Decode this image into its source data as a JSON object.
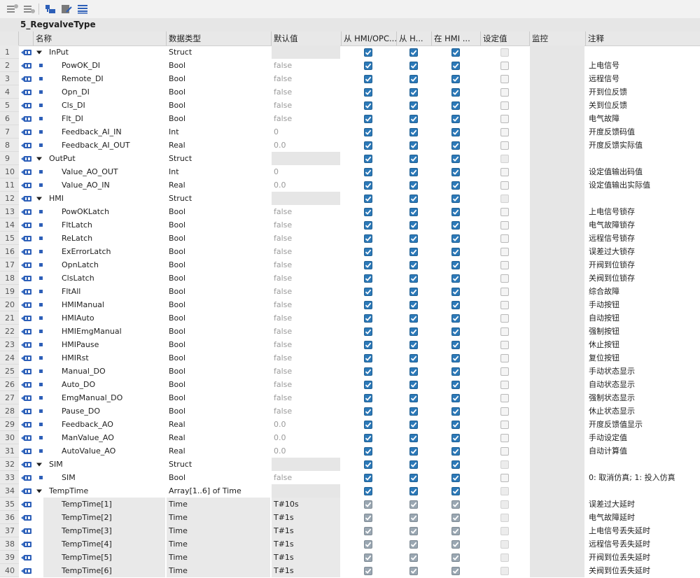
{
  "block_title": "5_RegvalveType",
  "toolbar": {
    "icons": [
      "insert-row-icon",
      "add-row-icon",
      "expand-icon",
      "monitor-icon",
      "details-icon"
    ]
  },
  "columns": {
    "name": "名称",
    "datatype": "数据类型",
    "default": "默认值",
    "hmi_opc": "从 HMI/OPC...",
    "hmi_h": "从 H...",
    "in_hmi": "在 HMI ...",
    "setpoint": "设定值",
    "monitor": "监控",
    "comment": "注释"
  },
  "colors": {
    "accent": "#2c79b8",
    "header_bg": "#e8e8e8"
  },
  "rows": [
    {
      "num": "1",
      "name": "InPut",
      "type": "Struct",
      "def": "",
      "level": 0,
      "struct": true,
      "comment": "",
      "c1": true,
      "c2": true,
      "c3": true,
      "c4": false
    },
    {
      "num": "2",
      "name": "PowOK_DI",
      "type": "Bool",
      "def": "false",
      "level": 1,
      "comment": "上电信号",
      "c1": true,
      "c2": true,
      "c3": true,
      "c4": false
    },
    {
      "num": "3",
      "name": "Remote_DI",
      "type": "Bool",
      "def": "false",
      "level": 1,
      "comment": "远程信号",
      "c1": true,
      "c2": true,
      "c3": true,
      "c4": false
    },
    {
      "num": "4",
      "name": "Opn_DI",
      "type": "Bool",
      "def": "false",
      "level": 1,
      "comment": "开到位反馈",
      "c1": true,
      "c2": true,
      "c3": true,
      "c4": false
    },
    {
      "num": "5",
      "name": "Cls_DI",
      "type": "Bool",
      "def": "false",
      "level": 1,
      "comment": "关到位反馈",
      "c1": true,
      "c2": true,
      "c3": true,
      "c4": false
    },
    {
      "num": "6",
      "name": "Flt_DI",
      "type": "Bool",
      "def": "false",
      "level": 1,
      "comment": "电气故障",
      "c1": true,
      "c2": true,
      "c3": true,
      "c4": false
    },
    {
      "num": "7",
      "name": "Feedback_AI_IN",
      "type": "Int",
      "def": "0",
      "level": 1,
      "comment": "开度反馈码值",
      "c1": true,
      "c2": true,
      "c3": true,
      "c4": false
    },
    {
      "num": "8",
      "name": "Feedback_AI_OUT",
      "type": "Real",
      "def": "0.0",
      "level": 1,
      "comment": "开度反馈实际值",
      "c1": true,
      "c2": true,
      "c3": true,
      "c4": false
    },
    {
      "num": "9",
      "name": "OutPut",
      "type": "Struct",
      "def": "",
      "level": 0,
      "struct": true,
      "comment": "",
      "c1": true,
      "c2": true,
      "c3": true,
      "c4": false
    },
    {
      "num": "10",
      "name": "Value_AO_OUT",
      "type": "Int",
      "def": "0",
      "level": 1,
      "comment": "设定值输出码值",
      "c1": true,
      "c2": true,
      "c3": true,
      "c4": false
    },
    {
      "num": "11",
      "name": "Value_AO_IN",
      "type": "Real",
      "def": "0.0",
      "level": 1,
      "comment": "设定值输出实际值",
      "c1": true,
      "c2": true,
      "c3": true,
      "c4": false
    },
    {
      "num": "12",
      "name": "HMI",
      "type": "Struct",
      "def": "",
      "level": 0,
      "struct": true,
      "comment": "",
      "c1": true,
      "c2": true,
      "c3": true,
      "c4": false
    },
    {
      "num": "13",
      "name": "PowOKLatch",
      "type": "Bool",
      "def": "false",
      "level": 1,
      "comment": "上电信号锁存",
      "c1": true,
      "c2": true,
      "c3": true,
      "c4": false
    },
    {
      "num": "14",
      "name": "FltLatch",
      "type": "Bool",
      "def": "false",
      "level": 1,
      "comment": "电气故障锁存",
      "c1": true,
      "c2": true,
      "c3": true,
      "c4": false
    },
    {
      "num": "15",
      "name": "ReLatch",
      "type": "Bool",
      "def": "false",
      "level": 1,
      "comment": "远程信号锁存",
      "c1": true,
      "c2": true,
      "c3": true,
      "c4": false
    },
    {
      "num": "16",
      "name": "ExErrorLatch",
      "type": "Bool",
      "def": "false",
      "level": 1,
      "comment": "误差过大锁存",
      "c1": true,
      "c2": true,
      "c3": true,
      "c4": false
    },
    {
      "num": "17",
      "name": "OpnLatch",
      "type": "Bool",
      "def": "false",
      "level": 1,
      "comment": "开阀到位锁存",
      "c1": true,
      "c2": true,
      "c3": true,
      "c4": false
    },
    {
      "num": "18",
      "name": "ClsLatch",
      "type": "Bool",
      "def": "false",
      "level": 1,
      "comment": "关阀到位锁存",
      "c1": true,
      "c2": true,
      "c3": true,
      "c4": false
    },
    {
      "num": "19",
      "name": "FltAll",
      "type": "Bool",
      "def": "false",
      "level": 1,
      "comment": "综合故障",
      "c1": true,
      "c2": true,
      "c3": true,
      "c4": false
    },
    {
      "num": "20",
      "name": "HMIManual",
      "type": "Bool",
      "def": "false",
      "level": 1,
      "comment": "手动按钮",
      "c1": true,
      "c2": true,
      "c3": true,
      "c4": false
    },
    {
      "num": "21",
      "name": "HMIAuto",
      "type": "Bool",
      "def": "false",
      "level": 1,
      "comment": "自动按钮",
      "c1": true,
      "c2": true,
      "c3": true,
      "c4": false
    },
    {
      "num": "22",
      "name": "HMIEmgManual",
      "type": "Bool",
      "def": "false",
      "level": 1,
      "comment": "强制按钮",
      "c1": true,
      "c2": true,
      "c3": true,
      "c4": false
    },
    {
      "num": "23",
      "name": "HMIPause",
      "type": "Bool",
      "def": "false",
      "level": 1,
      "comment": "休止按钮",
      "c1": true,
      "c2": true,
      "c3": true,
      "c4": false
    },
    {
      "num": "24",
      "name": "HMIRst",
      "type": "Bool",
      "def": "false",
      "level": 1,
      "comment": "复位按钮",
      "c1": true,
      "c2": true,
      "c3": true,
      "c4": false
    },
    {
      "num": "25",
      "name": "Manual_DO",
      "type": "Bool",
      "def": "false",
      "level": 1,
      "comment": "手动状态显示",
      "c1": true,
      "c2": true,
      "c3": true,
      "c4": false
    },
    {
      "num": "26",
      "name": "Auto_DO",
      "type": "Bool",
      "def": "false",
      "level": 1,
      "comment": "自动状态显示",
      "c1": true,
      "c2": true,
      "c3": true,
      "c4": false
    },
    {
      "num": "27",
      "name": "EmgManual_DO",
      "type": "Bool",
      "def": "false",
      "level": 1,
      "comment": "强制状态显示",
      "c1": true,
      "c2": true,
      "c3": true,
      "c4": false
    },
    {
      "num": "28",
      "name": "Pause_DO",
      "type": "Bool",
      "def": "false",
      "level": 1,
      "comment": "休止状态显示",
      "c1": true,
      "c2": true,
      "c3": true,
      "c4": false
    },
    {
      "num": "29",
      "name": "Feedback_AO",
      "type": "Real",
      "def": "0.0",
      "level": 1,
      "comment": "开度反馈值显示",
      "c1": true,
      "c2": true,
      "c3": true,
      "c4": false
    },
    {
      "num": "30",
      "name": "ManValue_AO",
      "type": "Real",
      "def": "0.0",
      "level": 1,
      "comment": "手动设定值",
      "c1": true,
      "c2": true,
      "c3": true,
      "c4": false
    },
    {
      "num": "31",
      "name": "AutoValue_AO",
      "type": "Real",
      "def": "0.0",
      "level": 1,
      "comment": "自动计算值",
      "c1": true,
      "c2": true,
      "c3": true,
      "c4": false
    },
    {
      "num": "32",
      "name": "SIM",
      "type": "Struct",
      "def": "",
      "level": 0,
      "struct": true,
      "comment": "",
      "c1": true,
      "c2": true,
      "c3": true,
      "c4": false
    },
    {
      "num": "33",
      "name": "SIM",
      "type": "Bool",
      "def": "false",
      "level": 1,
      "comment": "0: 取消仿真; 1: 投入仿真",
      "c1": true,
      "c2": true,
      "c3": true,
      "c4": false
    },
    {
      "num": "34",
      "name": "TempTime",
      "type": "Array[1..6] of Time",
      "def": "",
      "level": 0,
      "struct": true,
      "comment": "",
      "c1": true,
      "c2": true,
      "c3": true,
      "c4": false
    },
    {
      "num": "35",
      "name": "TempTime[1]",
      "type": "Time",
      "def": "T#10s",
      "level": 1,
      "elem": true,
      "comment": "误差过大延时",
      "c1": true,
      "c2": true,
      "c3": true,
      "c4": false
    },
    {
      "num": "36",
      "name": "TempTime[2]",
      "type": "Time",
      "def": "T#1s",
      "level": 1,
      "elem": true,
      "comment": "电气故障延时",
      "c1": true,
      "c2": true,
      "c3": true,
      "c4": false
    },
    {
      "num": "37",
      "name": "TempTime[3]",
      "type": "Time",
      "def": "T#1s",
      "level": 1,
      "elem": true,
      "comment": "上电信号丢失延时",
      "c1": true,
      "c2": true,
      "c3": true,
      "c4": false
    },
    {
      "num": "38",
      "name": "TempTime[4]",
      "type": "Time",
      "def": "T#1s",
      "level": 1,
      "elem": true,
      "comment": "远程信号丢失延时",
      "c1": true,
      "c2": true,
      "c3": true,
      "c4": false
    },
    {
      "num": "39",
      "name": "TempTime[5]",
      "type": "Time",
      "def": "T#1s",
      "level": 1,
      "elem": true,
      "comment": "开阀到位丢失延时",
      "c1": true,
      "c2": true,
      "c3": true,
      "c4": false
    },
    {
      "num": "40",
      "name": "TempTime[6]",
      "type": "Time",
      "def": "T#1s",
      "level": 1,
      "elem": true,
      "comment": "关阀到位丢失延时",
      "c1": true,
      "c2": true,
      "c3": true,
      "c4": false
    }
  ]
}
